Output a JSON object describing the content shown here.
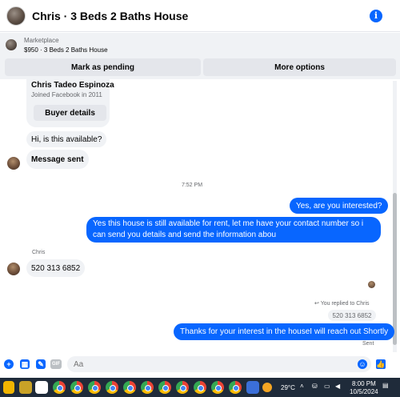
{
  "header": {
    "title": "Chris · 3 Beds 2 Baths House",
    "info_icon": "info-icon"
  },
  "marketplace": {
    "label": "Marketplace",
    "item": "$950 · 3 Beds 2 Baths House",
    "pending_button": "Mark as pending",
    "more_button": "More options"
  },
  "card": {
    "name": "Chris Tadeo Espinoza",
    "joined": "Joined Facebook in 2011",
    "button": "Buyer details"
  },
  "messages": {
    "m1": "Hi, is this available?",
    "m2": "Message sent",
    "time": "7:52 PM",
    "m3": "Yes, are you interested?",
    "m4": "Yes this house is still available for rent, let me have your contact number so i can send you details and send the information abou",
    "sender": "Chris",
    "m5": "520 313 6852",
    "replied": "You replied to Chris",
    "quoted": "520 313 6852",
    "m6": "Thanks for your interest in the houseI will reach out Shortly",
    "sent": "Sent"
  },
  "composer": {
    "placeholder": "Aa",
    "gif": "GIF"
  },
  "taskbar": {
    "weather": "29°C",
    "time": "8:00 PM",
    "date": "10/5/2024"
  },
  "colors": {
    "brand": "#0866ff",
    "bubble_in": "#f0f2f5",
    "taskbar": "#1f2b3a"
  }
}
